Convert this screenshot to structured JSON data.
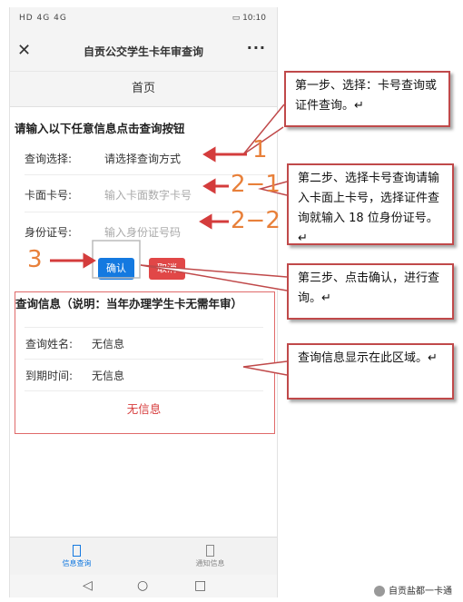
{
  "status_bar": {
    "left": "HD 4G 4G",
    "time": "10:10"
  },
  "title_bar": {
    "title": "自贡公交学生卡年审查询",
    "close_icon": "close-icon",
    "more_icon": "more-icon"
  },
  "nav": {
    "title": "首页"
  },
  "form": {
    "prompt": "请输入以下任意信息点击查询按钮",
    "query_type_label": "查询选择:",
    "query_type_value": "请选择查询方式",
    "card_label": "卡面卡号:",
    "card_placeholder": "输入卡面数字卡号",
    "id_label": "身份证号:",
    "id_placeholder": "输入身份证号码",
    "confirm_label": "确认",
    "cancel_label": "取消"
  },
  "result": {
    "title": "查询信息（说明：当年办理学生卡无需年审）",
    "name_label": "查询姓名:",
    "name_value": "无信息",
    "expiry_label": "到期时间:",
    "expiry_value": "无信息",
    "status": "无信息"
  },
  "tabs": [
    {
      "label": "信息查询",
      "icon": "info-query-icon",
      "active": true
    },
    {
      "label": "通知信息",
      "icon": "notice-icon",
      "active": false
    }
  ],
  "callouts": {
    "step1": "第一步、选择：卡号查询或证件查询。↵",
    "step2": "第二步、选择卡号查询请输入卡面上卡号，选择证件查询就输入 18 位身份证号。↵",
    "step3": "第三步、点击确认，进行查询。↵",
    "step4": "查询信息显示在此区域。↵"
  },
  "step_numbers": {
    "n1": "1",
    "n21": "2−1",
    "n22": "2−2",
    "n3": "3"
  },
  "watermark": "自贡盐都一卡通",
  "colors": {
    "primary": "#1479e0",
    "danger": "#e14747",
    "annotation": "#c0494a",
    "step_number": "#e8803a"
  }
}
